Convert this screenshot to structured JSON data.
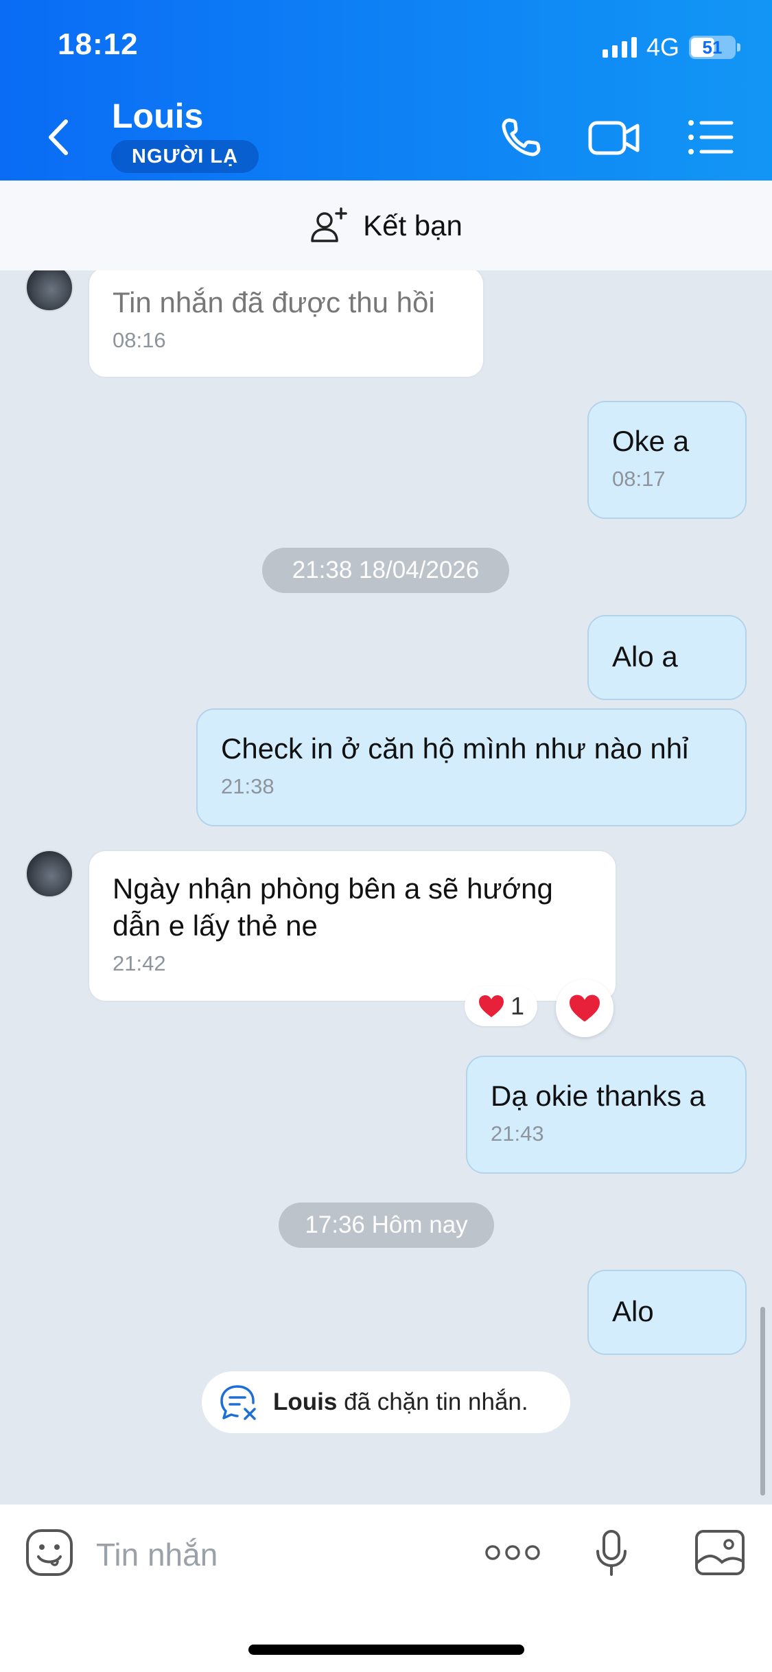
{
  "status_bar": {
    "time": "18:12",
    "network": "4G",
    "battery": "51"
  },
  "header": {
    "contact_name": "Louis",
    "badge": "NGƯỜI LẠ",
    "icons": [
      "back-icon",
      "phone-icon",
      "video-icon",
      "menu-icon"
    ]
  },
  "friend_bar": {
    "label": "Kết bạn",
    "icon": "add-friend-icon"
  },
  "messages": [
    {
      "from": "them",
      "text": "Tin nhắn đã được thu hồi",
      "time": "08:16",
      "recalled": true
    },
    {
      "from": "me",
      "text": "Oke a",
      "time": "08:17"
    },
    {
      "separator": "21:38 18/04/2026"
    },
    {
      "from": "me",
      "text": "Alo a"
    },
    {
      "from": "me",
      "text": "Check in ở căn hộ mình như nào nhỉ",
      "time": "21:38"
    },
    {
      "from": "them",
      "text": "Ngày nhận phòng bên a sẽ hướng dẫn e lấy thẻ ne",
      "time": "21:42",
      "reaction_count": "1"
    },
    {
      "from": "me",
      "text": "Dạ okie thanks a",
      "time": "21:43"
    },
    {
      "separator": "17:36 Hôm nay"
    },
    {
      "from": "me",
      "text": "Alo"
    }
  ],
  "blocked_notice": {
    "name": "Louis",
    "text": "đã chặn tin nhắn."
  },
  "input_bar": {
    "placeholder": "Tin nhắn",
    "icons": [
      "sticker-icon",
      "more-icon",
      "mic-icon",
      "image-icon"
    ]
  },
  "colors": {
    "header_start": "#0a6cf5",
    "header_end": "#1296f5",
    "out_bubble": "#d4edfd",
    "chat_bg": "#e2e8f0",
    "heart": "#e8213a"
  }
}
